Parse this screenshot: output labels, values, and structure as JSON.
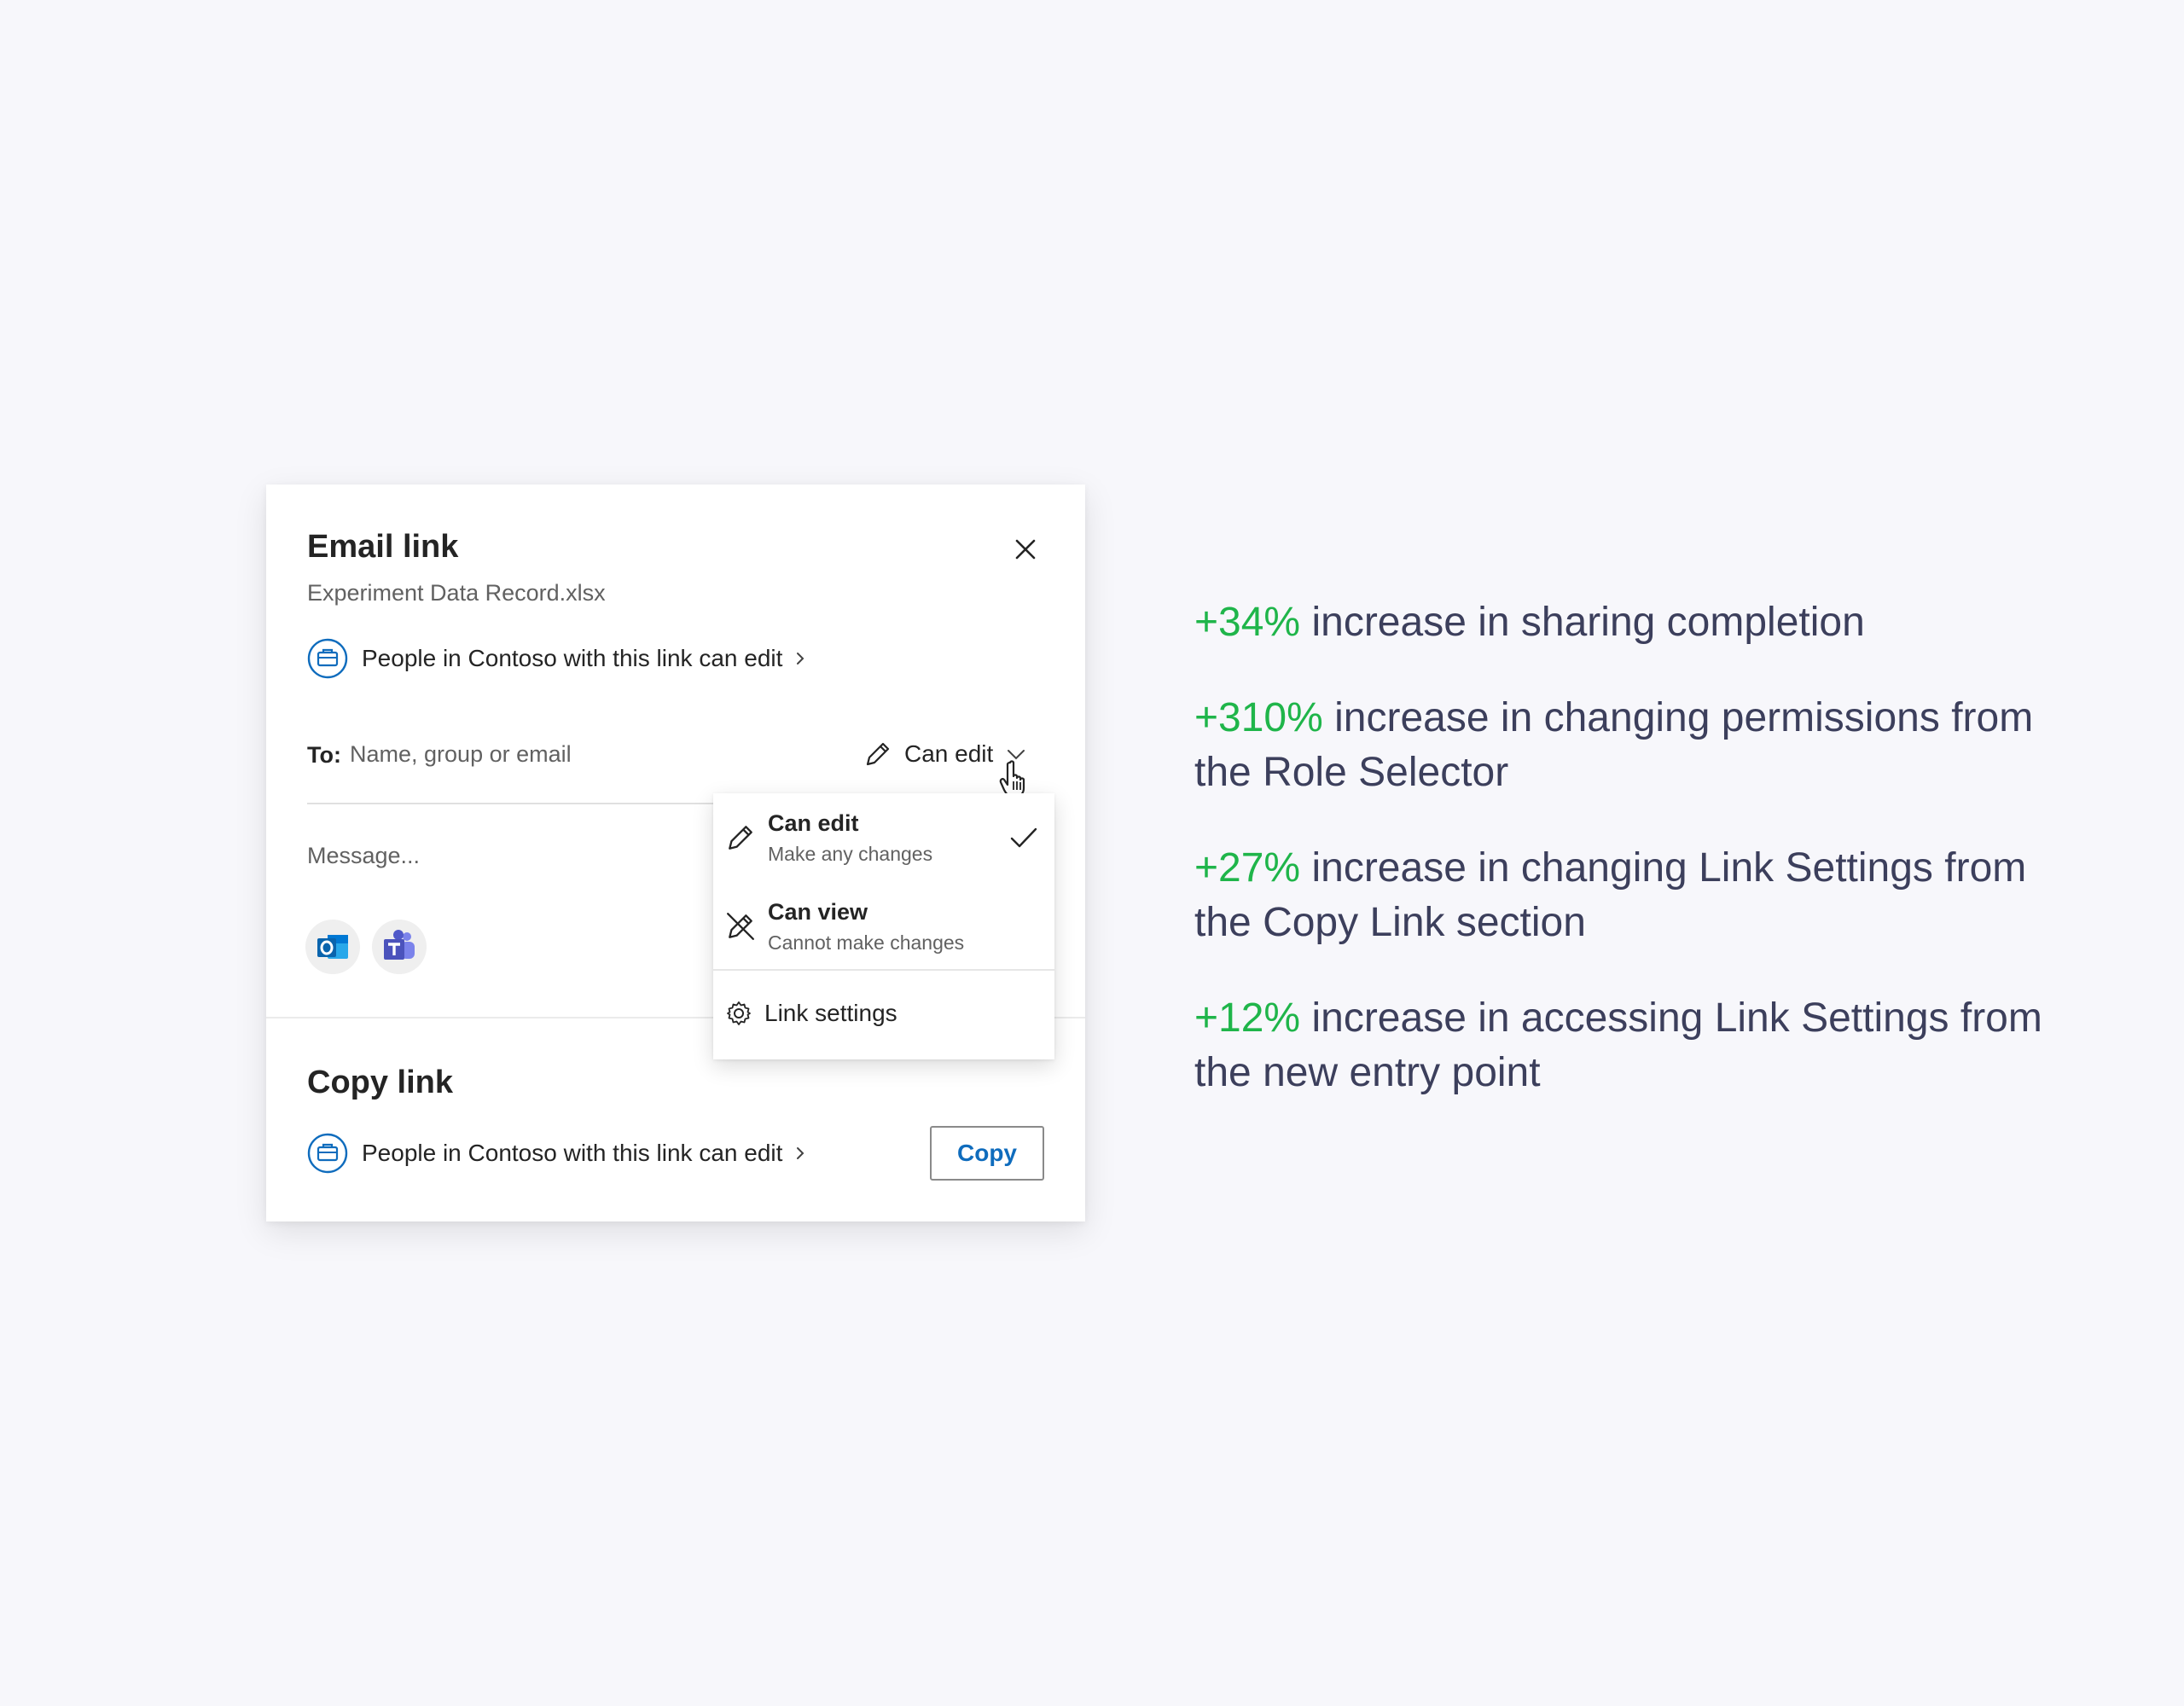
{
  "dialog": {
    "title": "Email link",
    "filename": "Experiment Data Record.xlsx",
    "link_scope": "People in Contoso with this link can edit",
    "to_label": "To:",
    "to_placeholder": "Name, group or email",
    "permission": "Can edit",
    "message_placeholder": "Message...",
    "apps": [
      {
        "name": "Outlook",
        "icon": "outlook-icon"
      },
      {
        "name": "Teams",
        "icon": "teams-icon"
      }
    ]
  },
  "copy_section": {
    "title": "Copy link",
    "link_scope": "People in Contoso with this link can edit",
    "copy_label": "Copy"
  },
  "permission_menu": {
    "items": [
      {
        "title": "Can edit",
        "subtitle": "Make any changes",
        "icon": "pencil-icon",
        "selected": true
      },
      {
        "title": "Can view",
        "subtitle": "Cannot make changes",
        "icon": "pencil-off-icon",
        "selected": false
      }
    ],
    "settings_label": "Link settings"
  },
  "stats": [
    {
      "pct": "+34%",
      "text": "increase in sharing completion"
    },
    {
      "pct": "+310%",
      "text": "increase in changing permissions from the Role Selector"
    },
    {
      "pct": "+27%",
      "text": "increase in changing Link Settings from the Copy Link section"
    },
    {
      "pct": "+12%",
      "text": "increase in accessing Link Settings from the new entry point"
    }
  ],
  "colors": {
    "accent_green": "#1fb54a",
    "link_blue": "#0f6cbd",
    "stat_text": "#3c3f5c",
    "background": "#f7f7fb"
  }
}
